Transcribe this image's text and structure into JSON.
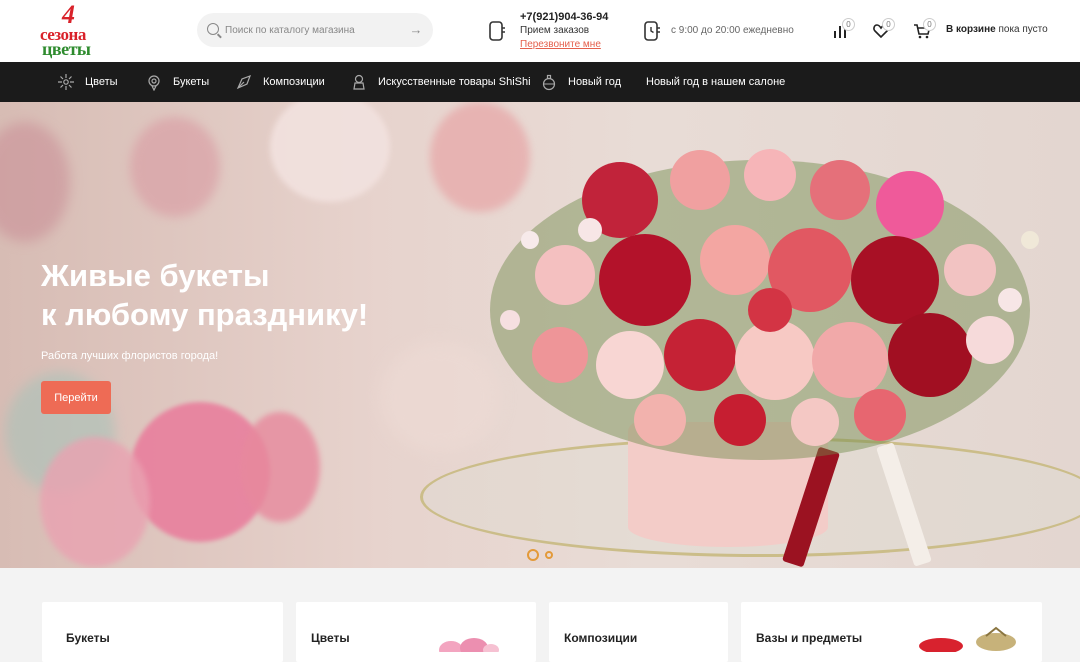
{
  "logo": {
    "number": "4",
    "line1": "сезона",
    "line2": "цветы"
  },
  "search": {
    "placeholder": "Поиск по каталогу магазина"
  },
  "contact": {
    "phone": "+7(921)904-36-94",
    "phone_caption": "Прием заказов",
    "callback": "Перезвоните мне",
    "hours": "с 9:00 до 20:00 ежедневно"
  },
  "header_icons": [
    {
      "name": "compare-icon",
      "count": "0"
    },
    {
      "name": "favorites-icon",
      "count": "0"
    },
    {
      "name": "cart-icon",
      "count": "0"
    }
  ],
  "cart": {
    "label_bold": "В корзине",
    "label_rest": "пока пусто"
  },
  "nav": {
    "items": [
      {
        "label": "Цветы",
        "icon": "flower-icon"
      },
      {
        "label": "Букеты",
        "icon": "bouquet-icon"
      },
      {
        "label": "Композиции",
        "icon": "composition-icon"
      },
      {
        "label": "Искусственные товары ShiShi",
        "icon": "artificial-flower-icon"
      },
      {
        "label": "Новый год",
        "icon": "christmas-ornament-icon"
      },
      {
        "label": "Новый год в нашем салоне",
        "icon": ""
      }
    ]
  },
  "hero": {
    "title_line1": "Живые букеты",
    "title_line2": "к любому празднику!",
    "subtitle": "Работа лучших флористов города!",
    "button": "Перейти",
    "slides_total": 2,
    "active_slide": 1
  },
  "categories": [
    {
      "title": "Букеты"
    },
    {
      "title": "Цветы"
    },
    {
      "title": "Композиции"
    },
    {
      "title": "Вазы и предметы"
    }
  ],
  "colors": {
    "accent": "#ee6b55",
    "nav_bg": "#1b1b1b",
    "logo_red": "#d9222a",
    "logo_green": "#2e8b2e"
  }
}
